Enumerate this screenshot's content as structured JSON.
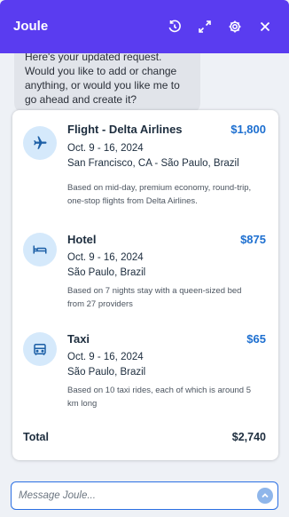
{
  "header": {
    "title": "Joule"
  },
  "chat": {
    "message": "Here's your updated request. Would you like to add or change anything, or would you like me to go ahead and create it?"
  },
  "items": [
    {
      "icon": "airplane-icon",
      "name": "Flight - Delta Airlines",
      "price": "$1,800",
      "dates": "Oct. 9 - 16, 2024",
      "route": "San Francisco, CA - São Paulo, Brazil",
      "note": "Based on mid-day, premium economy, round-trip, one-stop flights from Delta Airlines."
    },
    {
      "icon": "bed-icon",
      "name": "Hotel",
      "price": "$875",
      "dates": "Oct. 9 - 16, 2024",
      "route": "São Paulo, Brazil",
      "note": "Based on 7 nights stay with a queen-sized bed from 27 providers"
    },
    {
      "icon": "taxi-icon",
      "name": "Taxi",
      "price": "$65",
      "dates": "Oct. 9 - 16, 2024",
      "route": "São Paulo, Brazil",
      "note": "Based on 10 taxi rides, each of which is around 5 km long"
    }
  ],
  "total": {
    "label": "Total",
    "value": "$2,740"
  },
  "input": {
    "placeholder": "Message Joule..."
  },
  "colors": {
    "header": "#5a3cf0",
    "price": "#1d6fd0",
    "icon_bg": "#d5e9fb"
  }
}
